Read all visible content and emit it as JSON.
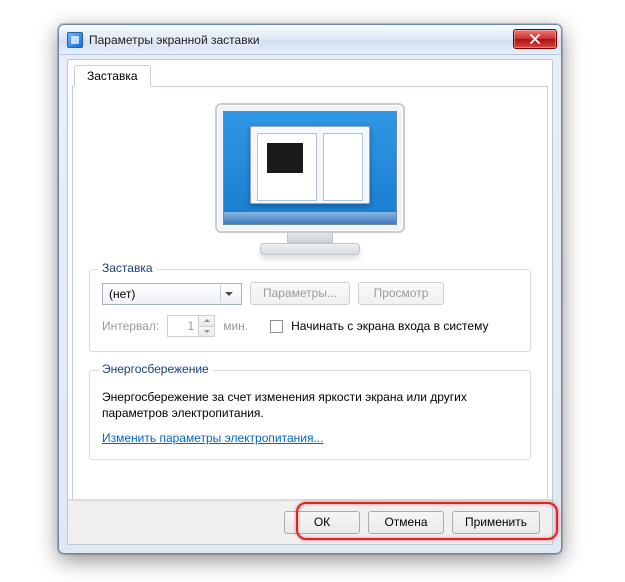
{
  "window": {
    "title": "Параметры экранной заставки"
  },
  "tab": {
    "label": "Заставка"
  },
  "screensaver_group": {
    "legend": "Заставка",
    "selected": "(нет)",
    "settings_btn": "Параметры...",
    "preview_btn": "Просмотр",
    "interval_label": "Интервал:",
    "interval_value": "1",
    "interval_unit": "мин.",
    "resume_checkbox": "Начинать с экрана входа в систему"
  },
  "power_group": {
    "legend": "Энергосбережение",
    "text": "Энергосбережение за счет изменения яркости экрана или других параметров электропитания.",
    "link": "Изменить параметры электропитания..."
  },
  "footer": {
    "ok": "ОК",
    "cancel": "Отмена",
    "apply": "Применить"
  }
}
